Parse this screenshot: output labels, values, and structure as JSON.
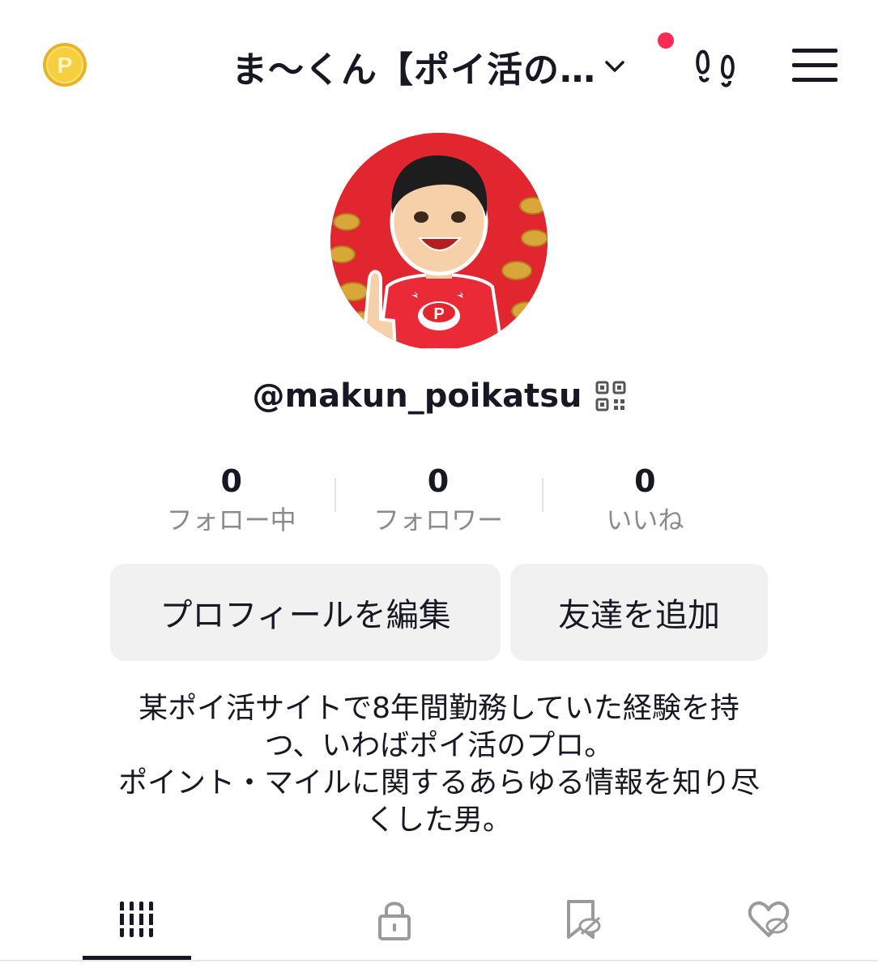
{
  "header": {
    "title": "ま〜くん【ポイ活の…",
    "coin_icon": "points-coin-icon",
    "footprint_icon": "footprint-icon",
    "menu_icon": "hamburger-menu-icon",
    "notification_color": "#fe2c55"
  },
  "profile": {
    "handle": "@makun_poikatsu",
    "avatar_bg": "#e2262f"
  },
  "stats": [
    {
      "value": "0",
      "label": "フォロー中"
    },
    {
      "value": "0",
      "label": "フォロワー"
    },
    {
      "value": "0",
      "label": "いいね"
    }
  ],
  "buttons": {
    "edit_profile": "プロフィールを編集",
    "add_friends": "友達を追加"
  },
  "bio": {
    "lines": [
      "某ポイ活サイトで8年間勤務していた経験を持",
      "つ、いわばポイ活のプロ。",
      "ポイント・マイルに関するあらゆる情報を知り尽",
      "くした男。"
    ]
  },
  "tabs": [
    {
      "icon": "grid-videos-icon",
      "active": true
    },
    {
      "icon": "lock-icon",
      "active": false
    },
    {
      "icon": "bookmark-hidden-icon",
      "active": false
    },
    {
      "icon": "liked-hidden-icon",
      "active": false
    }
  ]
}
